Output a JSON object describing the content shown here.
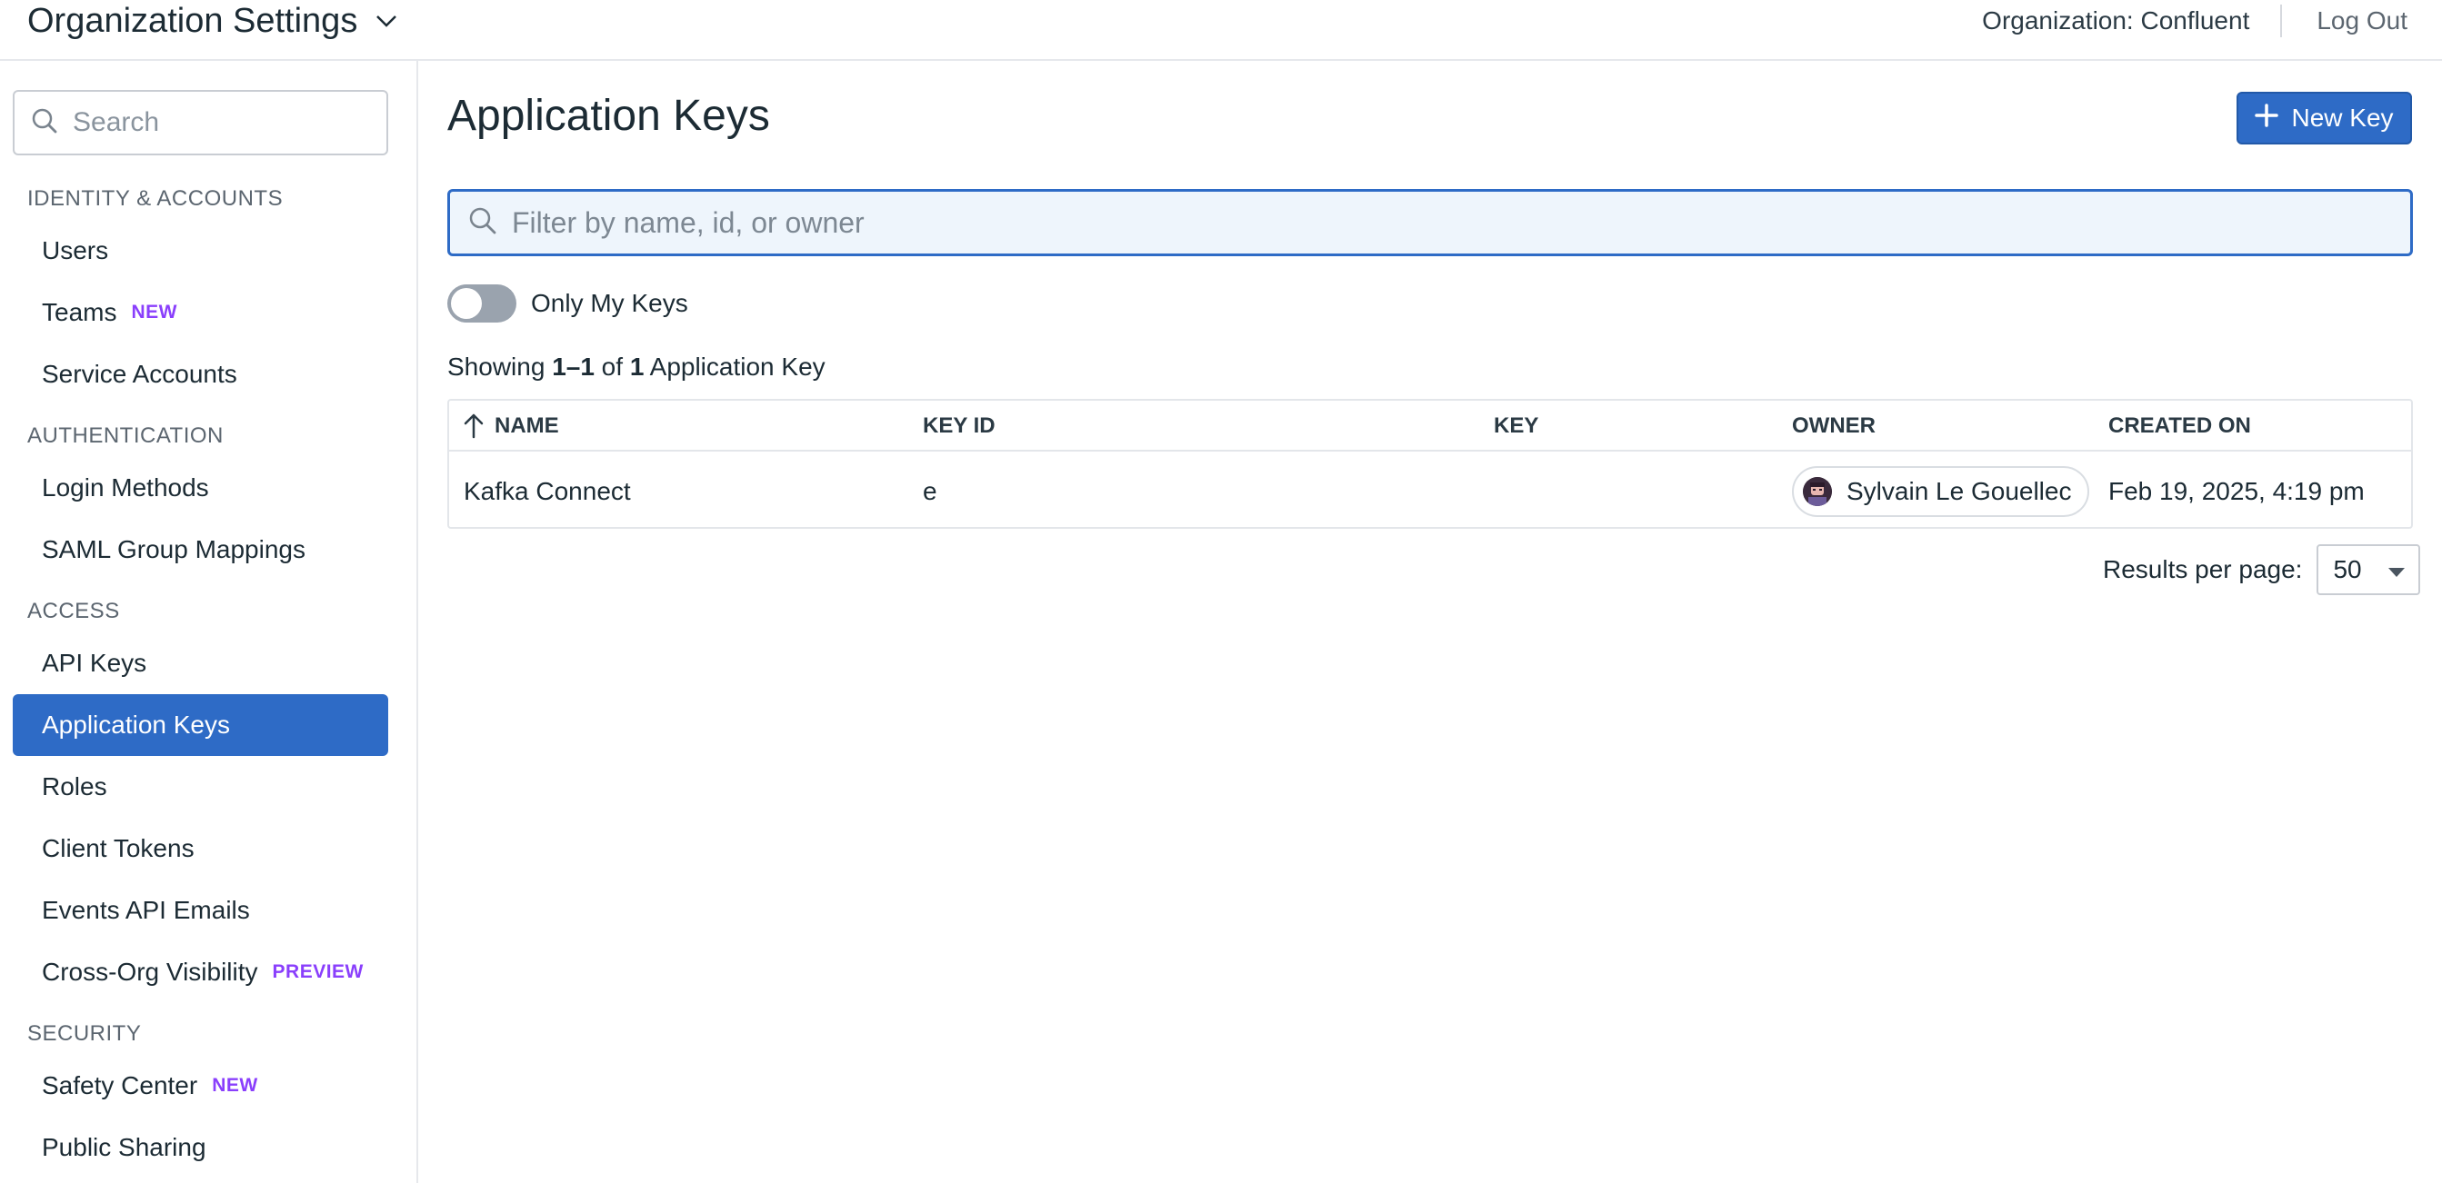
{
  "header": {
    "title": "Organization Settings",
    "org_label": "Organization: Confluent",
    "logout_label": "Log Out"
  },
  "sidebar": {
    "search_placeholder": "Search",
    "sections": {
      "identity": "IDENTITY & ACCOUNTS",
      "authentication": "AUTHENTICATION",
      "access": "ACCESS",
      "security": "SECURITY"
    },
    "items": [
      {
        "label": "Users"
      },
      {
        "label": "Teams",
        "badge": "NEW"
      },
      {
        "label": "Service Accounts"
      },
      {
        "label": "Login Methods"
      },
      {
        "label": "SAML Group Mappings"
      },
      {
        "label": "API Keys"
      },
      {
        "label": "Application Keys",
        "active": true
      },
      {
        "label": "Roles"
      },
      {
        "label": "Client Tokens"
      },
      {
        "label": "Events API Emails"
      },
      {
        "label": "Cross-Org Visibility",
        "badge": "PREVIEW"
      },
      {
        "label": "Safety Center",
        "badge": "NEW"
      },
      {
        "label": "Public Sharing"
      }
    ]
  },
  "main": {
    "title": "Application Keys",
    "new_key_label": "New Key",
    "filter_placeholder": "Filter by name, id, or owner",
    "toggle_label": "Only My Keys",
    "toggle_on": false,
    "showing": {
      "prefix": "Showing ",
      "range": "1–1",
      "of": " of ",
      "total": "1",
      "suffix": " Application Key"
    },
    "table": {
      "columns": [
        "NAME",
        "KEY ID",
        "KEY",
        "OWNER",
        "CREATED ON"
      ],
      "rows": [
        {
          "name": "Kafka Connect",
          "key_id": "e",
          "key": "",
          "owner": "Sylvain Le Gouellec",
          "created_on": "Feb 19, 2025, 4:19 pm"
        }
      ]
    },
    "pagination": {
      "per_page_label": "Results per page:",
      "per_page_value": "50"
    }
  },
  "colors": {
    "accent": "#2e6bc6",
    "badge": "#8a3ffc"
  }
}
